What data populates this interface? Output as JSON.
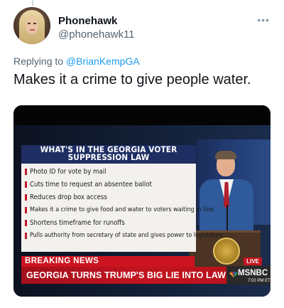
{
  "tweet": {
    "display_name": "Phonehawk",
    "handle": "@phonehawk11",
    "more_icon": "•••",
    "replying_to_prefix": "Replying to",
    "replying_to_handle": "@BrianKempGA",
    "text": "Makes it a crime to give people water."
  },
  "media": {
    "panel_title_line1": "WHAT'S IN THE GEORGIA VOTER",
    "panel_title_line2": "SUPPRESSION LAW",
    "items": [
      "Photo ID for vote by mail",
      "Cuts time to request an absentee ballot",
      "Reduces drop box access",
      "Makes it a crime to give food and water to voters waiting in line",
      "Shortens timeframe for runoffs",
      "Pulls authority from secretary of state and gives power to legislature"
    ],
    "breaking_news": "BREAKING NEWS",
    "headline": "GEORGIA TURNS TRUMP'S BIG LIE INTO LAW",
    "live_badge": "LIVE",
    "network": "MSNBC",
    "clock": "7:02 PM ET"
  },
  "colors": {
    "link": "#1d9bf0",
    "banner_red": "#c3141f",
    "panel_navy": "#1e2e63"
  }
}
